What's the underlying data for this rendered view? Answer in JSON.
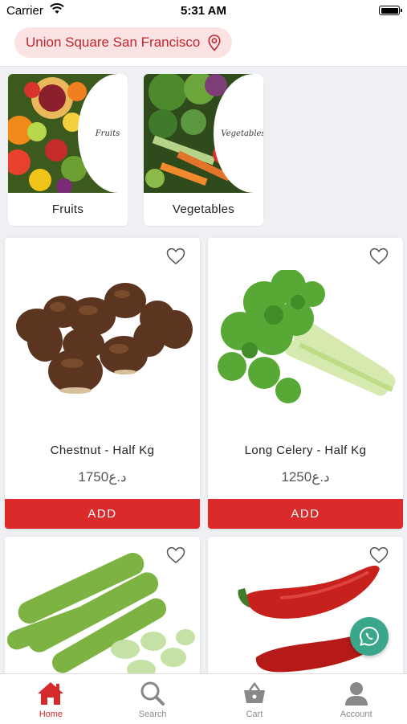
{
  "status_bar": {
    "carrier": "Carrier",
    "time": "5:31 AM"
  },
  "header": {
    "location": "Union Square San Francisco",
    "location_icon": "map-pin-icon"
  },
  "categories": [
    {
      "label": "Fruits",
      "badge": "Fruits"
    },
    {
      "label": "Vegetables",
      "badge": "Vegetables"
    }
  ],
  "products": [
    {
      "name": "Chestnut - Half Kg",
      "price": "1750د.ع",
      "add_label": "ADD"
    },
    {
      "name": "Long Celery - Half Kg",
      "price": "1250د.ع",
      "add_label": "ADD"
    },
    {
      "name": "",
      "price": "",
      "add_label": ""
    },
    {
      "name": "",
      "price": "",
      "add_label": ""
    }
  ],
  "tabs": [
    {
      "label": "Home",
      "icon": "home-icon",
      "active": true
    },
    {
      "label": "Search",
      "icon": "search-icon",
      "active": false
    },
    {
      "label": "Cart",
      "icon": "cart-icon",
      "active": false
    },
    {
      "label": "Account",
      "icon": "account-icon",
      "active": false
    }
  ],
  "colors": {
    "accent": "#db2a2a",
    "pill_bg": "#fbe3e3",
    "whatsapp": "#3aa68a"
  }
}
